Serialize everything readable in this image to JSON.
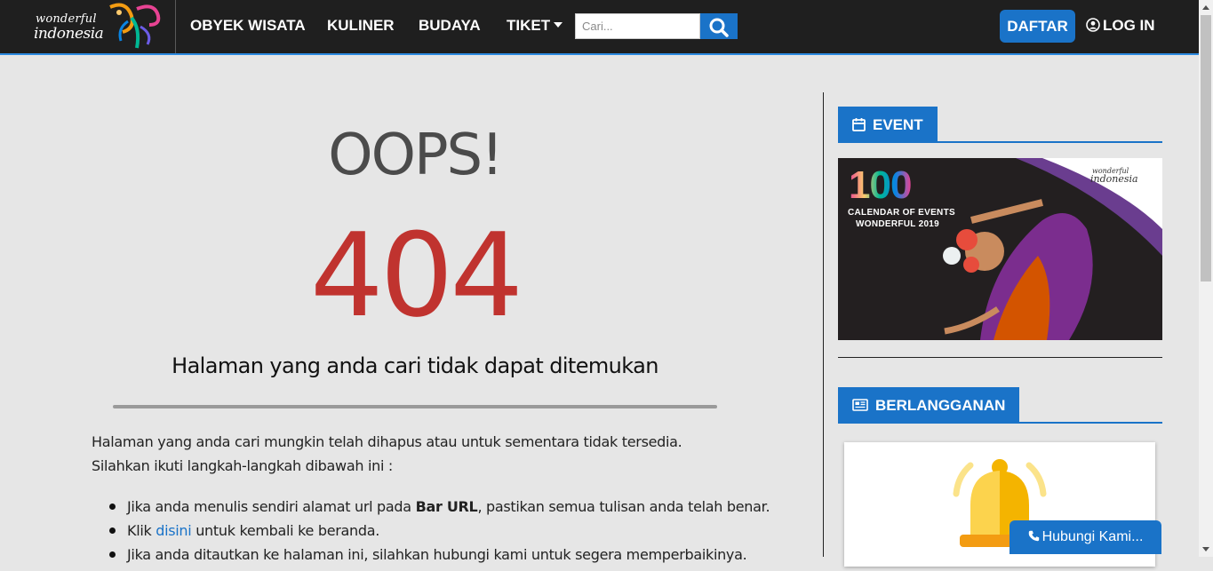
{
  "brand": {
    "line1": "wonderful",
    "line2": "indonesia"
  },
  "nav": {
    "items": [
      {
        "label": "OBYEK WISATA"
      },
      {
        "label": "KULINER"
      },
      {
        "label": "BUDAYA"
      },
      {
        "label": "TIKET"
      }
    ],
    "search_placeholder": "Cari...",
    "register_label": "DAFTAR",
    "login_label": "LOG IN"
  },
  "error": {
    "heading": "OOPS!",
    "code": "404",
    "message": "Halaman yang anda cari tidak dapat ditemukan",
    "intro_line1": "Halaman yang anda cari mungkin telah dihapus atau untuk sementara tidak tersedia.",
    "intro_line2": "Silahkan ikuti langkah-langkah dibawah ini :",
    "steps": [
      {
        "pre": "Jika anda menulis sendiri alamat url pada ",
        "bold": "Bar URL",
        "post": ", pastikan semua tulisan anda telah benar."
      },
      {
        "pre": "Klik ",
        "link": "disini",
        "post": " untuk kembali ke beranda."
      },
      {
        "pre": "Jika anda ditautkan ke halaman ini, silahkan hubungi kami untuk segera memperbaikinya."
      }
    ]
  },
  "sidebar": {
    "event_title": "EVENT",
    "event_banner": {
      "number": "100",
      "caption_line1": "CALENDAR OF EVENTS",
      "caption_line2": "WONDERFUL 2019",
      "logo_line1": "wonderful",
      "logo_line2": "indonesia"
    },
    "subscribe_title": "BERLANGGANAN"
  },
  "contact_button": "Hubungi Kami...",
  "colors": {
    "accent": "#1a73c8",
    "error_red": "#c0332f",
    "nav_bg": "#1f1f1f",
    "page_bg": "#e6e6e6"
  }
}
